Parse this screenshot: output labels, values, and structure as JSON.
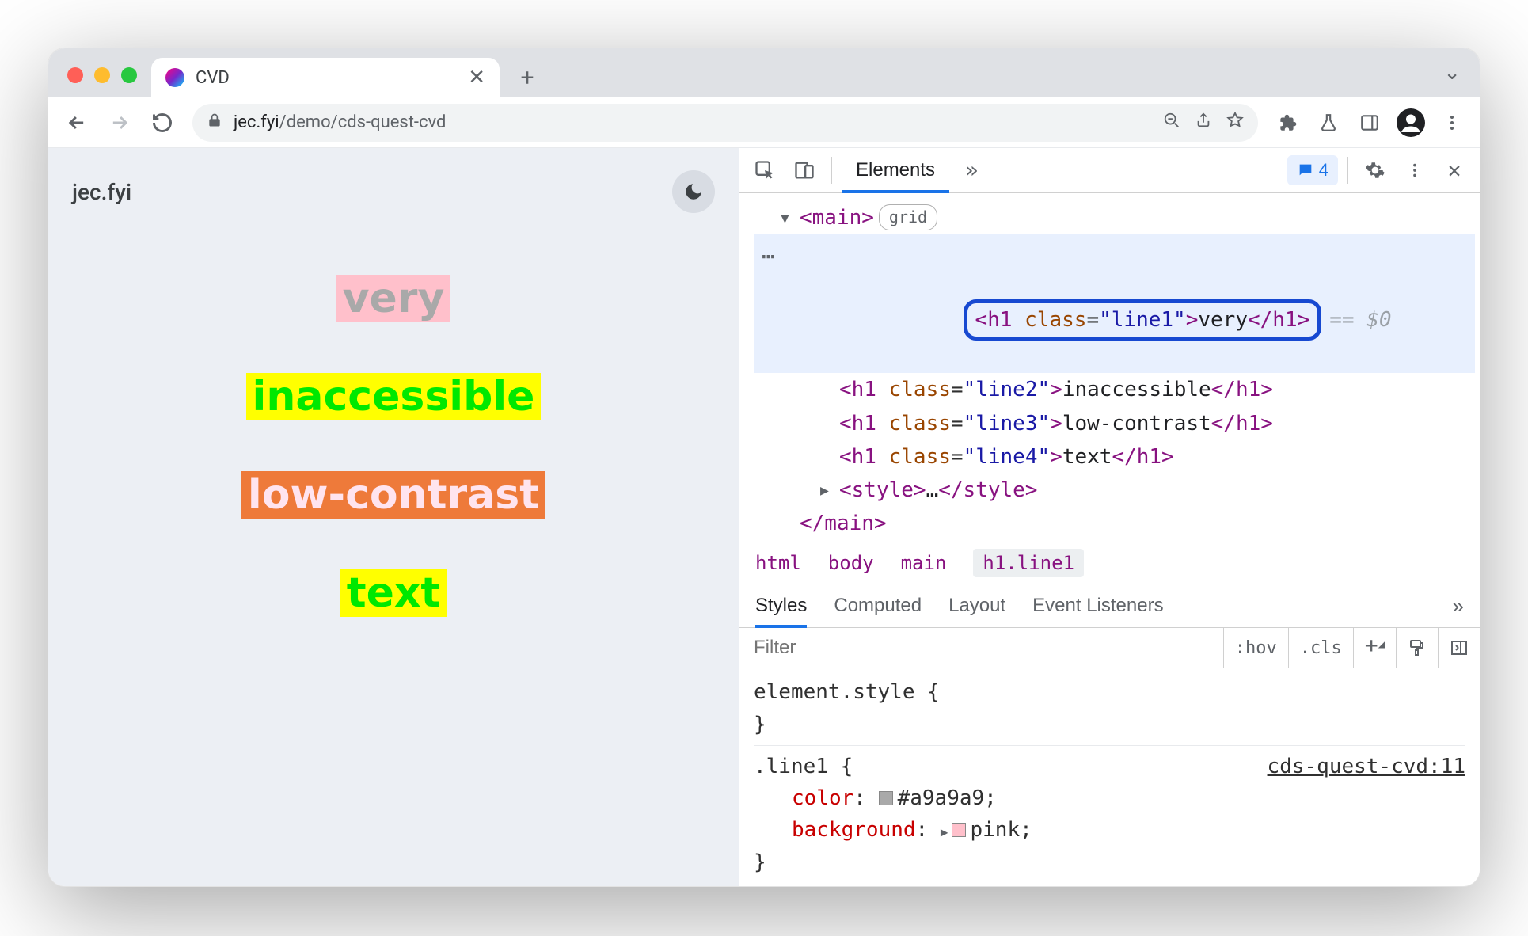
{
  "browser": {
    "tab_title": "CVD",
    "url_domain": "jec.fyi",
    "url_path": "/demo/cds-quest-cvd"
  },
  "page": {
    "site_name": "jec.fyi",
    "lines": {
      "line1": "very",
      "line2": "inaccessible",
      "line3": "low-contrast",
      "line4": "text"
    }
  },
  "devtools": {
    "active_panel": "Elements",
    "issues_count": "4",
    "dom": {
      "main_badge": "grid",
      "h1_line1_class": "line1",
      "h1_line1_text": "very",
      "h1_line2_class": "line2",
      "h1_line2_text": "inaccessible",
      "h1_line3_class": "line3",
      "h1_line3_text": "low-contrast",
      "h1_line4_class": "line4",
      "h1_line4_text": "text",
      "selected_ref": "== $0"
    },
    "crumbs": {
      "c0": "html",
      "c1": "body",
      "c2": "main",
      "c3": "h1.line1"
    },
    "subtabs": {
      "t0": "Styles",
      "t1": "Computed",
      "t2": "Layout",
      "t3": "Event Listeners"
    },
    "filter_placeholder": "Filter",
    "filter_btns": {
      "hov": ":hov",
      "cls": ".cls"
    },
    "styles": {
      "element_style_label": "element.style {",
      "element_style_close": "}",
      "rule_selector": ".line1 {",
      "rule_source": "cds-quest-cvd:11",
      "prop_color_name": "color",
      "prop_color_value": "#a9a9a9",
      "prop_bg_name": "background",
      "prop_bg_value": "pink",
      "rule_close": "}",
      "swatches": {
        "color": "#a9a9a9",
        "bg": "#ffc0cb"
      }
    }
  }
}
